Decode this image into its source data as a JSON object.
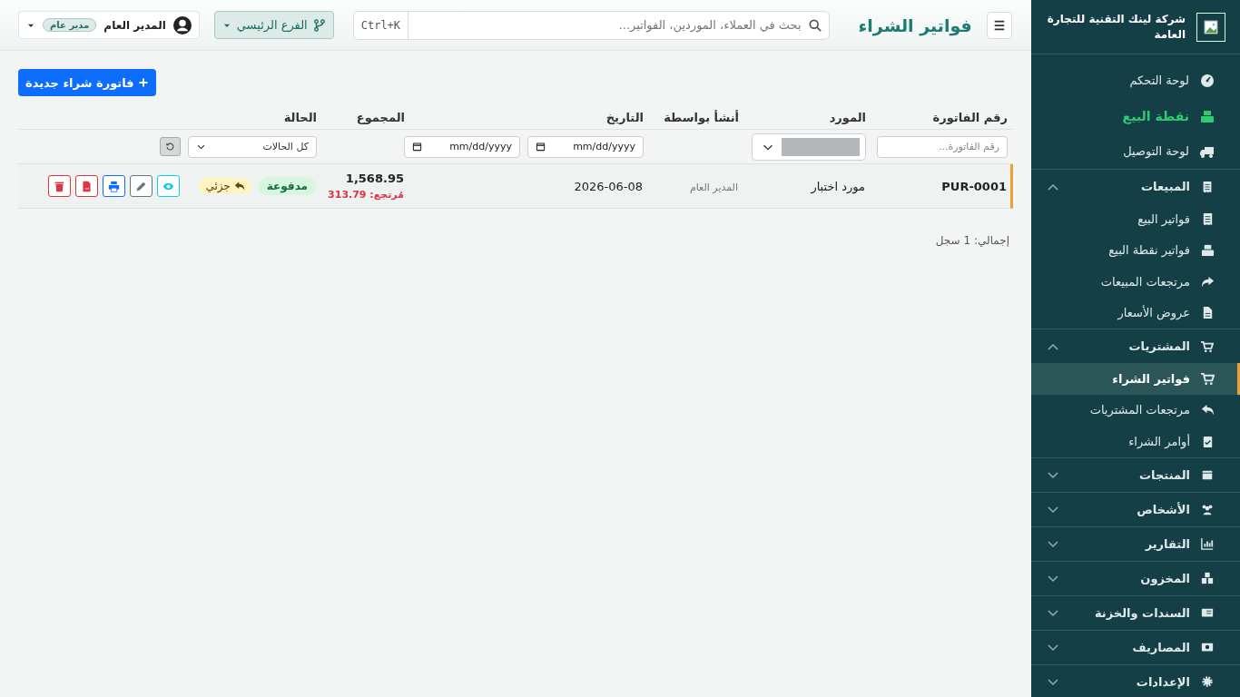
{
  "sidebar": {
    "brand": "شركة لينك التقنية للتجارة العامة",
    "nav": [
      {
        "kind": "link",
        "label": "لوحة التحكم",
        "selected": false
      },
      {
        "kind": "featured",
        "label": "نقطة البيع",
        "selected": false
      },
      {
        "kind": "link",
        "label": "لوحة التوصيل",
        "selected": false
      },
      {
        "kind": "group",
        "label": "المبيعات",
        "expanded": true,
        "children": [
          {
            "label": "فواتير البيع",
            "selected": false
          },
          {
            "label": "فواتير نقطة البيع",
            "selected": false
          },
          {
            "label": "مرتجعات المبيعات",
            "selected": false
          },
          {
            "label": "عروض الأسعار",
            "selected": false
          }
        ]
      },
      {
        "kind": "group",
        "label": "المشتريات",
        "expanded": true,
        "children": [
          {
            "label": "فواتير الشراء",
            "selected": true
          },
          {
            "label": "مرتجعات المشتريات",
            "selected": false
          },
          {
            "label": "أوامر الشراء",
            "selected": false
          }
        ]
      },
      {
        "kind": "group",
        "label": "المنتجات",
        "expanded": false
      },
      {
        "kind": "group",
        "label": "الأشخاص",
        "expanded": false
      },
      {
        "kind": "group",
        "label": "التقارير",
        "expanded": false
      },
      {
        "kind": "group",
        "label": "المخزون",
        "expanded": false
      },
      {
        "kind": "group",
        "label": "السندات والخزنة",
        "expanded": false
      },
      {
        "kind": "group",
        "label": "المصاريف",
        "expanded": false
      },
      {
        "kind": "group",
        "label": "الإعدادات",
        "expanded": false
      }
    ]
  },
  "topbar": {
    "title": "فواتير الشراء",
    "search": {
      "placeholder": "بحث في العملاء، الموردين، الفواتير...",
      "shortcut": "Ctrl+K"
    },
    "branch": "الفرع الرئيسي",
    "user": {
      "name": "المدير العام",
      "role": "مدير عام"
    }
  },
  "new_button": "فاتورة شراء جديدة",
  "table": {
    "columns": [
      "رقم الفاتورة",
      "المورد",
      "أنشأ بواسطة",
      "التاريخ",
      "المجموع",
      "الحالة"
    ],
    "filters": {
      "invoice_placeholder": "رقم الفاتورة...",
      "date_from": "mm/dd/yyyy",
      "date_to": "mm/dd/yyyy",
      "status": "كل الحالات"
    },
    "rows": [
      {
        "number": "PUR-0001",
        "supplier": "مورد اختبار",
        "created_by": "المدير العام",
        "date": "2026-06-08",
        "total": "1,568.95",
        "returned": "مُرتجع: 313.79",
        "status": "مدفوعة",
        "return_status": "جزئي",
        "actions": [
          {
            "kind": "view"
          },
          {
            "kind": "edit"
          },
          {
            "kind": "print"
          },
          {
            "kind": "pdf"
          },
          {
            "kind": "delete"
          }
        ]
      }
    ]
  },
  "footer": "إجمالي: 1 سجل"
}
